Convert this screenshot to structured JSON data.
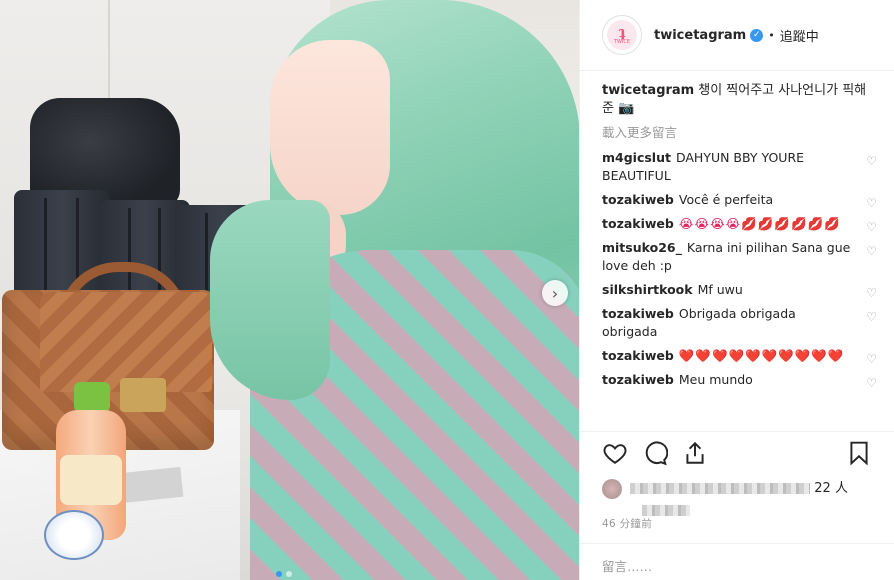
{
  "header": {
    "username": "twicetagram",
    "separator": "•",
    "follow_status": "追蹤中",
    "logo_mark": "ʇ",
    "logo_sub": "TWICE"
  },
  "caption": {
    "username": "twicetagram",
    "text": "챙이 찍어주고 사나언니가 픽해준 📷"
  },
  "load_more": "載入更多留言",
  "comments": [
    {
      "username": "m4gicslut",
      "text": "DAHYUN BBY YOURE BEAUTIFUL"
    },
    {
      "username": "tozakiweb",
      "text": "Você é perfeita"
    },
    {
      "username": "tozakiweb",
      "text": "😭😭😭😭💋💋💋💋💋💋"
    },
    {
      "username": "mitsuko26_",
      "text": "Karna ini pilihan Sana gue love deh :p"
    },
    {
      "username": "silkshirtkook",
      "text": "Mf uwu"
    },
    {
      "username": "tozakiweb",
      "text": "Obrigada obrigada obrigada"
    },
    {
      "username": "tozakiweb",
      "text": "❤️❤️❤️❤️❤️❤️❤️❤️❤️❤️"
    },
    {
      "username": "tozakiweb",
      "text": "Meu mundo"
    }
  ],
  "likes": {
    "count_suffix": "22 人"
  },
  "timestamp": "46 分鐘前",
  "add_comment_placeholder": "留言……",
  "colors": {
    "accent_blue": "#3897f0",
    "logo_pink": "#f0557a",
    "hair_mint": "#8fd2b7"
  },
  "icons": {
    "like": "heart-outline-icon",
    "comment": "speech-bubble-icon",
    "share": "share-arrow-icon",
    "save": "bookmark-icon",
    "carousel_next": "chevron-right-icon",
    "verified": "verified-badge-icon"
  }
}
